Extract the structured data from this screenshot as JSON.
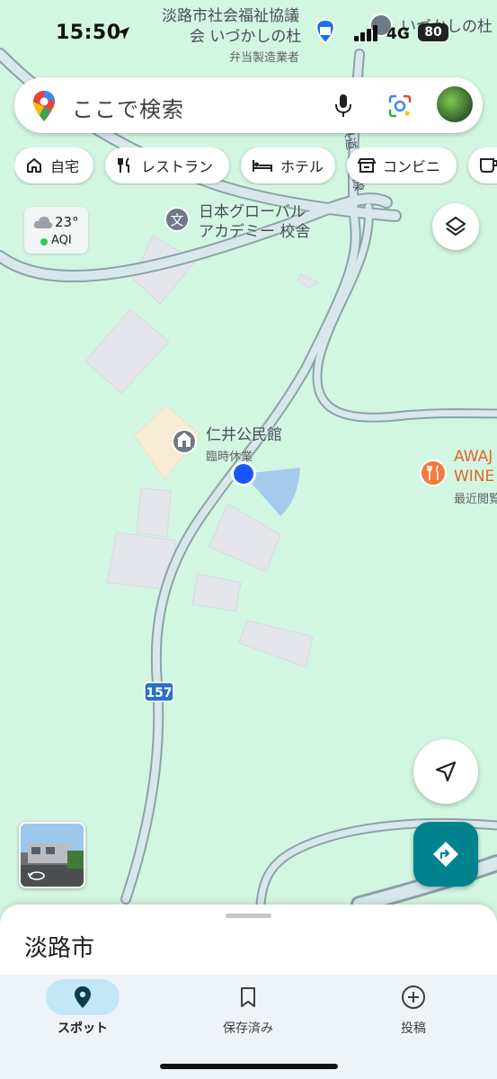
{
  "status_bar": {
    "time": "15:50",
    "network": "4G",
    "battery": "80"
  },
  "search": {
    "placeholder": "ここで検索"
  },
  "chips": [
    "自宅",
    "レストラン",
    "ホテル",
    "コンビニ"
  ],
  "weather": {
    "temp": "23°",
    "aqi_label": "AQI"
  },
  "map_labels": {
    "welfare_line1": "淡路市社会福祉協議",
    "welfare_line2": "会 いづかしの杜",
    "welfare_sub": "弁当製造業者",
    "top_right": "いづかしの杜",
    "school_line1": "日本グローバル",
    "school_line2": "アカデミー 校舎",
    "hall": "仁井公民館",
    "hall_status": "臨時休業",
    "winery_line1": "AWAJ",
    "winery_line2": "WINE",
    "winery_sub": "最近閲覧",
    "road_number": "157",
    "road_name": "県道 仁井線"
  },
  "sheet": {
    "title": "淡路市"
  },
  "bottom_nav": {
    "explore": "スポット",
    "saved": "保存済み",
    "contribute": "投稿"
  },
  "colors": {
    "map_bg": "#d3f6e2",
    "road": "#9bb3b4",
    "building": "#e4e7ec",
    "accent_teal": "#00838f",
    "location_blue": "#1a56ff"
  }
}
